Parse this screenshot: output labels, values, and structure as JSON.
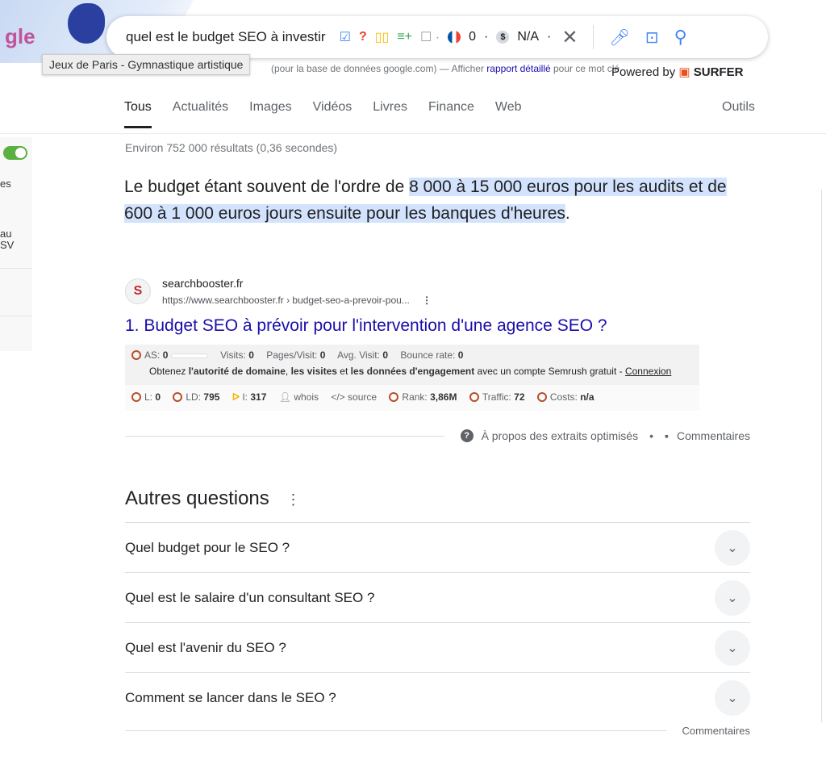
{
  "doodle": {
    "logo_text": "gle",
    "tooltip": "Jeux de Paris - Gymnastique artistique"
  },
  "search": {
    "query": "quel est le budget SEO à investir",
    "flag_count": "0",
    "cost": "N/A"
  },
  "keyword_line": {
    "prefix": "(pour la base de données google.com) — Afficher ",
    "link": "rapport détaillé",
    "suffix": " pour ce mot clé"
  },
  "powered": {
    "label": "Powered by",
    "brand": "SURFER"
  },
  "tabs": [
    {
      "label": "Tous",
      "active": true
    },
    {
      "label": "Actualités"
    },
    {
      "label": "Images"
    },
    {
      "label": "Vidéos"
    },
    {
      "label": "Livres"
    },
    {
      "label": "Finance"
    },
    {
      "label": "Web"
    }
  ],
  "tools": "Outils",
  "sidebar": {
    "text1": "es",
    "text2": "au",
    "text3": "SV"
  },
  "stats": "Environ 752 000 résultats (0,36 secondes)",
  "answer": {
    "before": "Le budget étant souvent de l'ordre de ",
    "highlight": "8 000 à 15 000 euros pour les audits et de 600 à 1 000 euros jours ensuite pour les banques d'heures",
    "after": "."
  },
  "result": {
    "favicon": "S",
    "site": "searchbooster.fr",
    "url": "https://www.searchbooster.fr › budget-seo-a-prevoir-pou...",
    "title": "1. Budget SEO à prévoir pour l'intervention d'une agence SEO ?"
  },
  "semrush": {
    "row1": [
      {
        "label": "AS: ",
        "value": "0"
      },
      {
        "label": "Visits: ",
        "value": "0"
      },
      {
        "label": "Pages/Visit: ",
        "value": "0"
      },
      {
        "label": "Avg. Visit: ",
        "value": "0"
      },
      {
        "label": "Bounce rate: ",
        "value": "0"
      }
    ],
    "promo": {
      "t1": "Obtenez ",
      "b1": "l'autorité de domaine",
      "t2": ", ",
      "b2": "les visites",
      "t3": " et ",
      "b3": "les données d'engagement",
      "t4": " avec un compte Semrush gratuit - ",
      "link": "Connexion"
    },
    "row2": [
      {
        "label": "L: ",
        "value": "0"
      },
      {
        "label": "LD: ",
        "value": "795"
      },
      {
        "label": "I: ",
        "value": "317"
      },
      {
        "label": "whois"
      },
      {
        "label": "source"
      },
      {
        "label": "Rank: ",
        "value": "3,86M"
      },
      {
        "label": "Traffic: ",
        "value": "72"
      },
      {
        "label": "Costs: ",
        "value": "n/a"
      }
    ]
  },
  "about": {
    "label": "À propos des extraits optimisés",
    "feedback": "Commentaires"
  },
  "paa": {
    "title": "Autres questions",
    "items": [
      "Quel budget pour le SEO ?",
      "Quel est le salaire d'un consultant SEO ?",
      "Quel est l'avenir du SEO ?",
      "Comment se lancer dans le SEO ?"
    ],
    "feedback": "Commentaires"
  },
  "colors": {
    "link": "#1a0dab",
    "highlight": "#d3e3fd",
    "toggle": "#5bb042",
    "semrush_icon": "#b5502c"
  }
}
